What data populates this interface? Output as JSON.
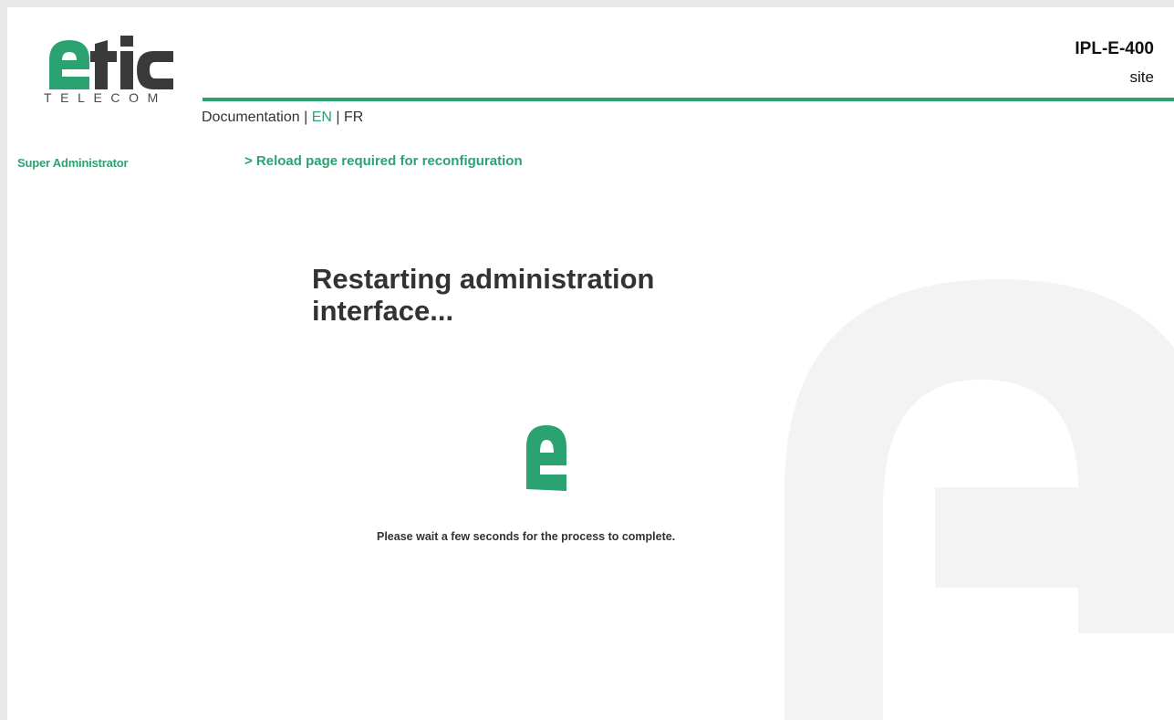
{
  "brand": {
    "logo_word": "etic",
    "logo_sub": "TELECOM",
    "accent_color": "#2ba272",
    "dark_color": "#3a3a3a"
  },
  "device": {
    "name": "IPL-E-400",
    "role": "site"
  },
  "nav": {
    "documentation": "Documentation",
    "sep": "|",
    "lang_en": "EN",
    "lang_fr": "FR"
  },
  "sidebar": {
    "user_role": "Super Administrator"
  },
  "notice": {
    "reload": "> Reload page required for reconfiguration"
  },
  "main": {
    "title": "Restarting administration interface...",
    "wait_message": "Please wait a few seconds for the process to complete.",
    "spinner_icon": "etic-e-logo-icon"
  }
}
